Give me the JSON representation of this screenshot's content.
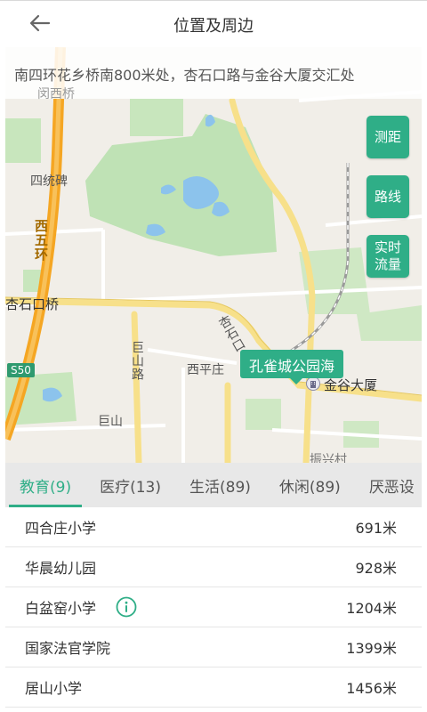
{
  "header": {
    "title": "位置及周边",
    "back_icon": "back-arrow-icon"
  },
  "map": {
    "address": "南四环花乡桥南800米处，杏石口路与金谷大厦交汇处",
    "labels": {
      "minxi_bridge": "闵西桥",
      "sitong_bei": "四统碑",
      "west_5th_ring": "西五环",
      "xingshikou_bridge": "杏石口桥",
      "jushan_road": "巨山路",
      "xingshi_road": "杏石口",
      "xipingzhuang": "西平庄",
      "jushan": "巨山",
      "jingu_tower": "金谷大厦",
      "zhenxingcun": "振兴村",
      "s50": "S50"
    },
    "poi_callout": "孔雀城公园海",
    "buttons": {
      "measure": "测距",
      "route": "路线",
      "traffic": "实时流量"
    }
  },
  "tabs": [
    {
      "label": "教育(9)",
      "active": true
    },
    {
      "label": "医疗(13)",
      "active": false
    },
    {
      "label": "生活(89)",
      "active": false
    },
    {
      "label": "休闲(89)",
      "active": false
    },
    {
      "label": "厌恶设",
      "active": false
    }
  ],
  "places": [
    {
      "name": "四合庄小学",
      "distance": "691米",
      "info": false
    },
    {
      "name": "华晨幼儿园",
      "distance": "928米",
      "info": false
    },
    {
      "name": "白盆窑小学",
      "distance": "1204米",
      "info": true
    },
    {
      "name": "国家法官学院",
      "distance": "1399米",
      "info": false
    },
    {
      "name": "居山小学",
      "distance": "1456米",
      "info": false
    }
  ],
  "colors": {
    "accent": "#2fae87",
    "park": "#bfe2b5",
    "water": "#8cc3ec",
    "highway": "#f5a623",
    "road_yellow": "#f7e08a"
  }
}
